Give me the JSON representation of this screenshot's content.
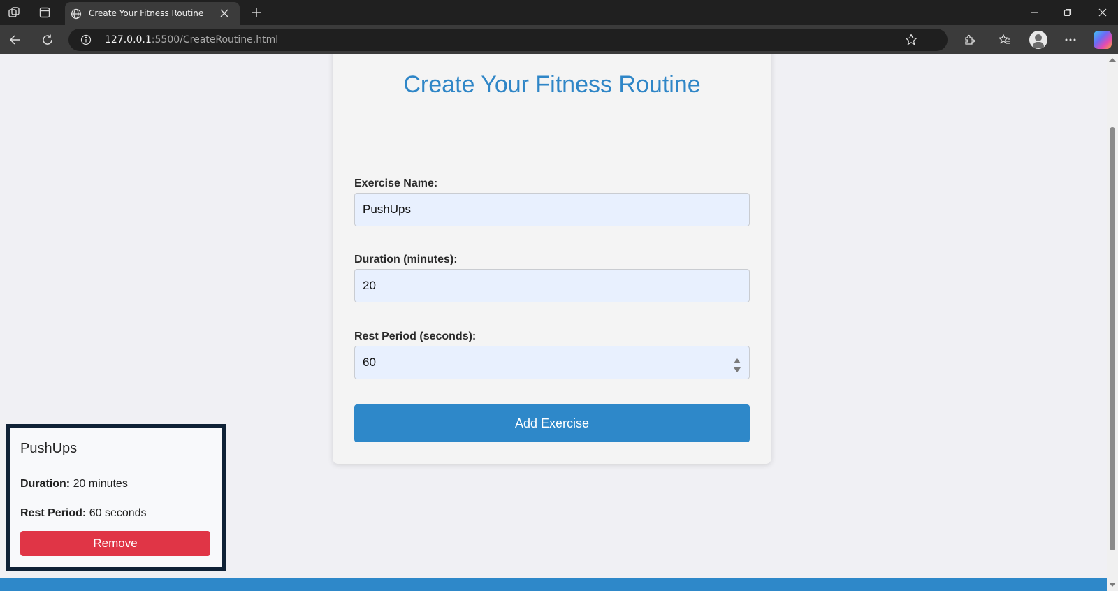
{
  "browser": {
    "tab_title": "Create Your Fitness Routine",
    "url_host": "127.0.0.1",
    "url_path": ":5500/CreateRoutine.html"
  },
  "form": {
    "title": "Create Your Fitness Routine",
    "exercise_name_label": "Exercise Name:",
    "exercise_name_value": "PushUps",
    "duration_label": "Duration (minutes):",
    "duration_value": "20",
    "rest_label": "Rest Period (seconds):",
    "rest_value": "60",
    "add_button": "Add Exercise"
  },
  "exercises": [
    {
      "name": "PushUps",
      "duration_label": "Duration:",
      "duration_text": "20 minutes",
      "rest_label": "Rest Period:",
      "rest_text": "60 seconds",
      "remove_button": "Remove"
    }
  ],
  "colors": {
    "accent": "#2e88c9",
    "danger": "#e03546",
    "card_border": "#0f2136"
  }
}
